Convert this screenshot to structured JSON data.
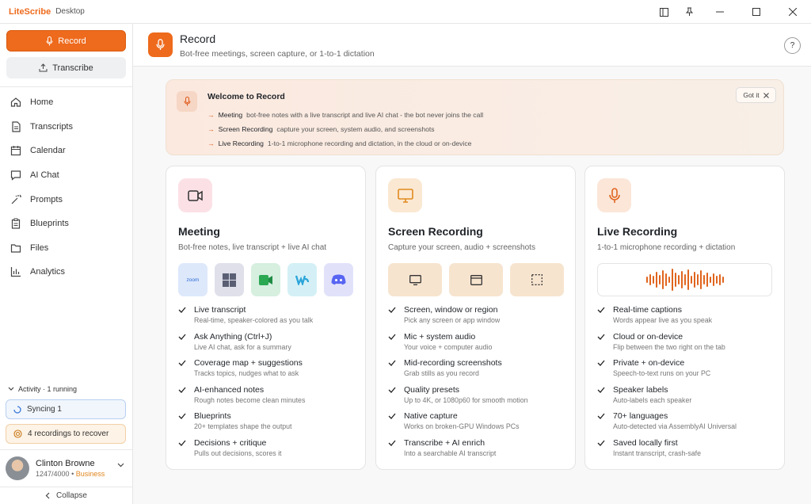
{
  "app": {
    "name": "LiteScribe",
    "subtitle": "Desktop"
  },
  "sidebar": {
    "record_label": "Record",
    "transcribe_label": "Transcribe",
    "nav": [
      {
        "label": "Home",
        "icon": "home-icon"
      },
      {
        "label": "Transcripts",
        "icon": "document-icon"
      },
      {
        "label": "Calendar",
        "icon": "calendar-icon"
      },
      {
        "label": "AI Chat",
        "icon": "chat-icon"
      },
      {
        "label": "Prompts",
        "icon": "magic-wand-icon"
      },
      {
        "label": "Blueprints",
        "icon": "clipboard-icon"
      },
      {
        "label": "Files",
        "icon": "folder-icon"
      },
      {
        "label": "Analytics",
        "icon": "bar-chart-icon"
      }
    ],
    "activity": "Activity · 1 running",
    "syncing": "Syncing 1",
    "recover": "4 recordings to recover",
    "user": {
      "name": "Clinton Browne",
      "usage": "1247/4000",
      "plan": "Business"
    },
    "collapse": "Collapse"
  },
  "header": {
    "title": "Record",
    "subtitle": "Bot-free meetings, screen capture, or 1-to-1 dictation"
  },
  "welcome": {
    "title": "Welcome to Record",
    "got_it": "Got it",
    "lines": [
      {
        "key": "Meeting",
        "text": "bot-free notes with a live transcript and live AI chat - the bot never joins the call"
      },
      {
        "key": "Screen Recording",
        "text": "capture your screen, system audio, and screenshots"
      },
      {
        "key": "Live Recording",
        "text": "1-to-1 microphone recording and dictation, in the cloud or on-device"
      }
    ]
  },
  "cards": [
    {
      "title": "Meeting",
      "subtitle": "Bot-free notes, live transcript + live AI chat",
      "chips": [
        "zoom",
        "Microsoft Teams",
        "Google Meet",
        "Webex",
        "Discord"
      ],
      "features": [
        {
          "title": "Live transcript",
          "desc": "Real-time, speaker-colored as you talk"
        },
        {
          "title": "Ask Anything (Ctrl+J)",
          "desc": "Live AI chat, ask for a summary"
        },
        {
          "title": "Coverage map + suggestions",
          "desc": "Tracks topics, nudges what to ask"
        },
        {
          "title": "AI-enhanced notes",
          "desc": "Rough notes become clean minutes"
        },
        {
          "title": "Blueprints",
          "desc": "20+ templates shape the output"
        },
        {
          "title": "Decisions + critique",
          "desc": "Pulls out decisions, scores it"
        }
      ]
    },
    {
      "title": "Screen Recording",
      "subtitle": "Capture your screen, audio + screenshots",
      "features": [
        {
          "title": "Screen, window or region",
          "desc": "Pick any screen or app window"
        },
        {
          "title": "Mic + system audio",
          "desc": "Your voice + computer audio"
        },
        {
          "title": "Mid-recording screenshots",
          "desc": "Grab stills as you record"
        },
        {
          "title": "Quality presets",
          "desc": "Up to 4K, or 1080p60 for smooth motion"
        },
        {
          "title": "Native capture",
          "desc": "Works on broken-GPU Windows PCs"
        },
        {
          "title": "Transcribe + AI enrich",
          "desc": "Into a searchable AI transcript"
        }
      ]
    },
    {
      "title": "Live Recording",
      "subtitle": "1-to-1 microphone recording + dictation",
      "features": [
        {
          "title": "Real-time captions",
          "desc": "Words appear live as you speak"
        },
        {
          "title": "Cloud or on-device",
          "desc": "Flip between the two right on the tab"
        },
        {
          "title": "Private + on-device",
          "desc": "Speech-to-text runs on your PC"
        },
        {
          "title": "Speaker labels",
          "desc": "Auto-labels each speaker"
        },
        {
          "title": "70+ languages",
          "desc": "Auto-detected via AssemblyAI Universal"
        },
        {
          "title": "Saved locally first",
          "desc": "Instant transcript, crash-safe"
        }
      ]
    }
  ],
  "colors": {
    "accent": "#ee6a1c",
    "check": "#222222"
  }
}
